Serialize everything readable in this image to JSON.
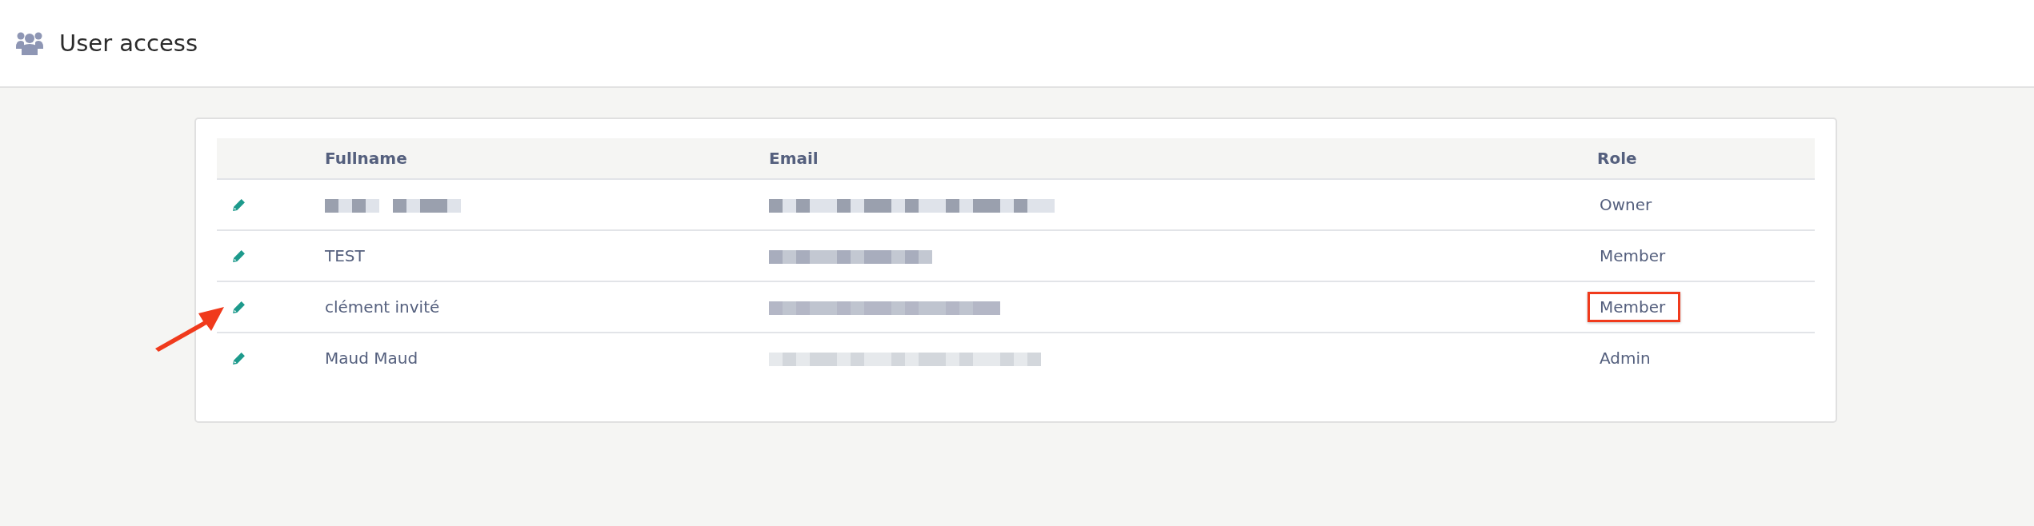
{
  "header": {
    "title": "User access"
  },
  "table": {
    "columns": [
      "Fullname",
      "Email",
      "Role"
    ],
    "rows": [
      {
        "name": {
          "kind": "redacted"
        },
        "email": {
          "kind": "redacted"
        },
        "role": "Owner",
        "highlighted": false,
        "arrow": false
      },
      {
        "name": {
          "kind": "text",
          "text": "TEST"
        },
        "email": {
          "kind": "redacted"
        },
        "role": "Member",
        "highlighted": false,
        "arrow": false
      },
      {
        "name": {
          "kind": "text",
          "text": "clément invité"
        },
        "email": {
          "kind": "redacted"
        },
        "role": "Member",
        "highlighted": true,
        "arrow": true
      },
      {
        "name": {
          "kind": "text",
          "text": "Maud Maud"
        },
        "email": {
          "kind": "redacted"
        },
        "role": "Admin",
        "highlighted": false,
        "arrow": false
      }
    ]
  }
}
